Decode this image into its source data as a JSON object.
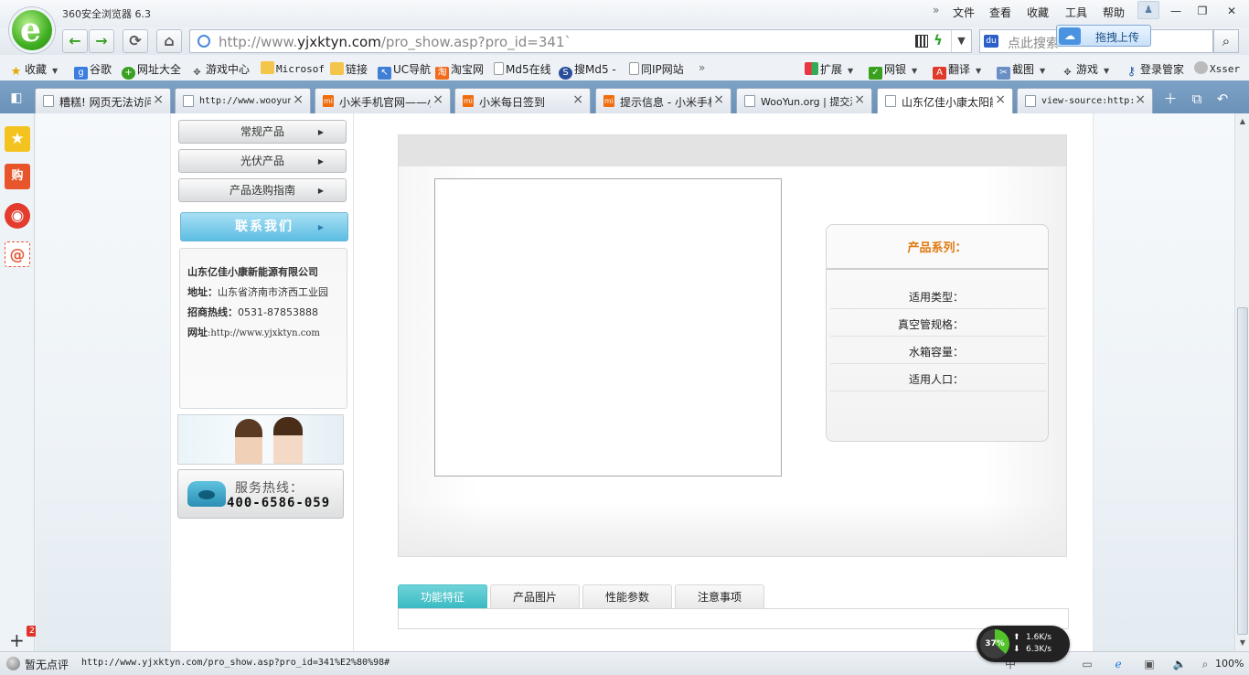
{
  "browser": {
    "title": "360安全浏览器 6.3",
    "menu": [
      "文件",
      "查看",
      "收藏",
      "工具",
      "帮助"
    ],
    "address": {
      "prefix": "http://www.",
      "domain": "yjxktyn.com",
      "path": "/pro_show.asp?pro_id=341`"
    },
    "search_placeholder": "点此搜索",
    "upload_popup": "拖拽上传"
  },
  "bookmarks": [
    {
      "label": "收藏",
      "icon": "star-add-icon",
      "dropdown": true
    },
    {
      "label": "谷歌",
      "icon": "google-icon"
    },
    {
      "label": "网址大全",
      "icon": "nav-360-icon"
    },
    {
      "label": "游戏中心",
      "icon": "gamepad-icon"
    },
    {
      "label": "Microsof",
      "icon": "folder-icon"
    },
    {
      "label": "链接",
      "icon": "folder-icon"
    },
    {
      "label": "UC导航",
      "icon": "uc-icon"
    },
    {
      "label": "淘宝网",
      "icon": "taobao-icon"
    },
    {
      "label": "Md5在线",
      "icon": "page-icon"
    },
    {
      "label": "搜Md5 -",
      "icon": "somd5-icon"
    },
    {
      "label": "同IP网站",
      "icon": "page-icon"
    }
  ],
  "toolbar_right": [
    {
      "label": "扩展",
      "icon": "grid-icon"
    },
    {
      "label": "网银",
      "icon": "shield-icon"
    },
    {
      "label": "翻译",
      "icon": "translate-icon"
    },
    {
      "label": "截图",
      "icon": "screenshot-icon"
    },
    {
      "label": "游戏",
      "icon": "game-icon"
    },
    {
      "label": "登录管家",
      "icon": "key-icon"
    },
    {
      "label": "Xsser",
      "icon": "user-icon"
    }
  ],
  "tabs": [
    {
      "title": "糟糕! 网页无法访问",
      "favicon": "page",
      "active": false
    },
    {
      "title": "http://www.wooyun.org",
      "favicon": "page",
      "active": false
    },
    {
      "title": "小米手机官网——小米",
      "favicon": "mi",
      "active": false
    },
    {
      "title": "小米每日签到",
      "favicon": "mi",
      "active": false
    },
    {
      "title": "提示信息 - 小米手机",
      "favicon": "mi",
      "active": false
    },
    {
      "title": "WooYun.org | 提交漏洞",
      "favicon": "page",
      "active": false
    },
    {
      "title": "山东亿佳小康太阳能",
      "favicon": "page",
      "active": true
    },
    {
      "title": "view-source:http://",
      "favicon": "page",
      "active": false
    }
  ],
  "page": {
    "categories": [
      "常规产品",
      "光伏产品",
      "产品选购指南"
    ],
    "contact_button": "联系我们",
    "contact": {
      "company": "山东亿佳小康新能源有限公司",
      "address_label": "地址：",
      "address": "山东省济南市济西工业园",
      "hotline_label": "招商热线：",
      "hotline": "0531-87853888",
      "site_label": "网址",
      "site": ":http://www.yjxktyn.com"
    },
    "service": {
      "label": "服务热线：",
      "number": "400-6586-059"
    },
    "product": {
      "series_title": "产品系列：",
      "specs": [
        "适用类型：",
        "真空管规格：",
        "水箱容量：",
        "适用人口："
      ]
    },
    "detail_tabs": [
      "功能特征",
      "产品图片",
      "性能参数",
      "注意事项"
    ]
  },
  "speed_widget": {
    "percent": "37%",
    "up": "1.6K/s",
    "down": "6.3K/s",
    "load_fraction": 0.37
  },
  "status": {
    "comment": "暂无点评",
    "url": "http://www.yjxktyn.com/pro_show.asp?pro_id=341%E2%80%98#",
    "zoom": "100%"
  },
  "colors": {
    "accent": "#3ab9c3",
    "series_title": "#e07a10",
    "tab_bar": "#7da2c6"
  }
}
